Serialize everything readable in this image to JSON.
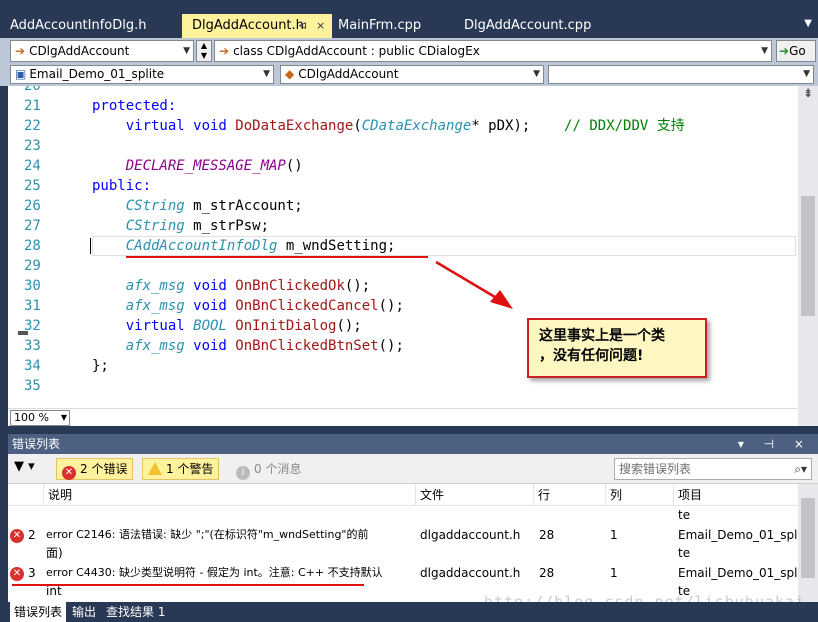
{
  "tabs": [
    {
      "label": "AddAccountInfoDlg.h",
      "active": false
    },
    {
      "label": "DlgAddAccount.h",
      "active": true,
      "pin": "⊲",
      "close": "×"
    },
    {
      "label": "MainFrm.cpp",
      "active": false
    },
    {
      "label": "DlgAddAccount.cpp",
      "active": false
    }
  ],
  "nav": {
    "class_combo": "CDlgAddAccount",
    "scope_combo": "class CDlgAddAccount : public CDialogEx",
    "go_label": "Go",
    "project_combo": "Email_Demo_01_splite",
    "member_combo": "CDlgAddAccount",
    "third_combo": ""
  },
  "code_lines": [
    {
      "num": "20",
      "tokens": []
    },
    {
      "num": "21",
      "tokens": [
        {
          "t": "protected:",
          "c": "kw"
        }
      ]
    },
    {
      "num": "22",
      "tokens": [
        {
          "t": "    virtual void ",
          "c": "kw"
        },
        {
          "t": "DoDataExchange",
          "c": "fn"
        },
        {
          "t": "(",
          "c": "plain"
        },
        {
          "t": "CDataExchange",
          "c": "ty"
        },
        {
          "t": "* pDX);    ",
          "c": "plain"
        },
        {
          "t": "// DDX/DDV 支持",
          "c": "cmt"
        }
      ]
    },
    {
      "num": "23",
      "tokens": []
    },
    {
      "num": "24",
      "tokens": [
        {
          "t": "    DECLARE_MESSAGE_MAP",
          "c": "mac"
        },
        {
          "t": "()",
          "c": "plain"
        }
      ]
    },
    {
      "num": "25",
      "tokens": [
        {
          "t": "public:",
          "c": "kw"
        }
      ]
    },
    {
      "num": "26",
      "tokens": [
        {
          "t": "    CString",
          "c": "ty"
        },
        {
          "t": " m_strAccount;",
          "c": "plain"
        }
      ]
    },
    {
      "num": "27",
      "tokens": [
        {
          "t": "    CString",
          "c": "ty"
        },
        {
          "t": " m_strPsw;",
          "c": "plain"
        }
      ]
    },
    {
      "num": "28",
      "tokens": [
        {
          "t": "    CAddAccountInfoDlg",
          "c": "ty"
        },
        {
          "t": " m_wndSetting;",
          "c": "plain"
        }
      ]
    },
    {
      "num": "29",
      "tokens": []
    },
    {
      "num": "30",
      "tokens": [
        {
          "t": "    afx_msg",
          "c": "ty"
        },
        {
          "t": " void ",
          "c": "kw"
        },
        {
          "t": "OnBnClickedOk",
          "c": "fn"
        },
        {
          "t": "();",
          "c": "plain"
        }
      ]
    },
    {
      "num": "31",
      "tokens": [
        {
          "t": "    afx_msg",
          "c": "ty"
        },
        {
          "t": " void ",
          "c": "kw"
        },
        {
          "t": "OnBnClickedCancel",
          "c": "fn"
        },
        {
          "t": "();",
          "c": "plain"
        }
      ]
    },
    {
      "num": "32",
      "tokens": [
        {
          "t": "    virtual ",
          "c": "kw"
        },
        {
          "t": "BOOL",
          "c": "ty"
        },
        {
          "t": " OnInitDialog",
          "c": "fn"
        },
        {
          "t": "();",
          "c": "plain"
        }
      ]
    },
    {
      "num": "33",
      "tokens": [
        {
          "t": "    afx_msg",
          "c": "ty"
        },
        {
          "t": " void ",
          "c": "kw"
        },
        {
          "t": "OnBnClickedBtnSet",
          "c": "fn"
        },
        {
          "t": "();",
          "c": "plain"
        }
      ]
    },
    {
      "num": "34",
      "tokens": [
        {
          "t": "};",
          "c": "plain"
        }
      ]
    },
    {
      "num": "35",
      "tokens": []
    }
  ],
  "callout": {
    "line1": "这里事实上是一个类",
    "line2": "，没有任何问题!"
  },
  "zoom": "100 %",
  "error_panel": {
    "title": "错误列表",
    "tools": "▾ ⊣ ×",
    "errors_btn": "2 个错误",
    "warnings_btn": "1 个警告",
    "messages_btn": "0 个消息",
    "search_placeholder": "搜索错误列表",
    "columns": [
      "说明",
      "文件",
      "行",
      "列",
      "项目"
    ],
    "rows": [
      {
        "num": "",
        "desc1": "",
        "desc2": "",
        "file": "",
        "line": "",
        "col": "",
        "proj1": "te",
        "proj2": ""
      },
      {
        "num": "2",
        "desc1": "error C2146: 语法错误: 缺少 \";\"(在标识符\"m_wndSetting\"的前",
        "desc2": "面)",
        "file": "dlgaddaccount.h",
        "line": "28",
        "col": "1",
        "proj1": "Email_Demo_01_spli",
        "proj2": "te"
      },
      {
        "num": "3",
        "desc1": "error C4430: 缺少类型说明符 - 假定为 int。注意: C++ 不支持默认",
        "desc2": "int",
        "file": "dlgaddaccount.h",
        "line": "28",
        "col": "1",
        "proj1": "Email_Demo_01_spli",
        "proj2": "te"
      }
    ]
  },
  "bottom_tabs": [
    "错误列表",
    "输出",
    "查找结果 1"
  ],
  "watermark": "http://blog.csdn.net/lishuhuakai",
  "colors": {
    "accent_tab": "#FFF29D",
    "vs_frame": "#293955",
    "annotation_red": "#E01010"
  }
}
